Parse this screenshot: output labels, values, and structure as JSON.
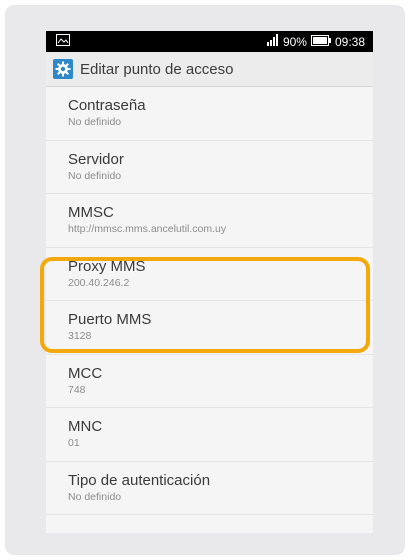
{
  "status_bar": {
    "battery": "90%",
    "time": "09:38"
  },
  "action_bar": {
    "title": "Editar punto de acceso",
    "icon": "gear-icon"
  },
  "settings": [
    {
      "title": "Contraseña",
      "value": "No definido"
    },
    {
      "title": "Servidor",
      "value": "No definido"
    },
    {
      "title": "MMSC",
      "value": "http://mmsc.mms.ancelutil.com.uy"
    },
    {
      "title": "Proxy MMS",
      "value": "200.40.246.2"
    },
    {
      "title": "Puerto MMS",
      "value": "3128"
    },
    {
      "title": "MCC",
      "value": "748"
    },
    {
      "title": "MNC",
      "value": "01"
    },
    {
      "title": "Tipo de autenticación",
      "value": "No definido"
    }
  ],
  "colors": {
    "highlight": "#f3a90c",
    "icon_blue": "#2f88c9"
  }
}
